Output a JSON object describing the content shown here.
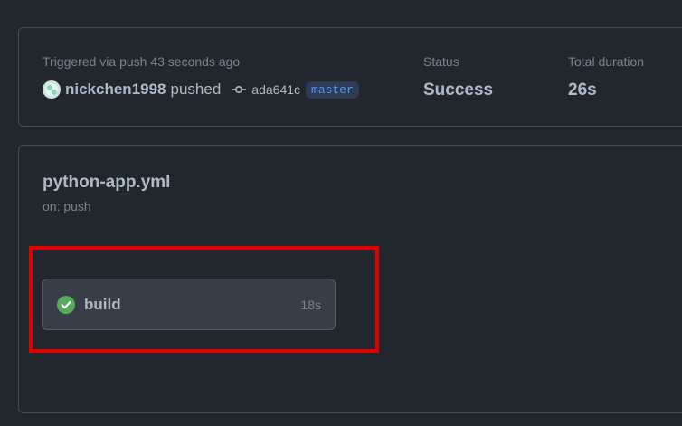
{
  "summary": {
    "trigger_text": "Triggered via push 43 seconds ago",
    "actor": "nickchen1998",
    "action": "pushed",
    "commit_sha": "ada641c",
    "branch": "master",
    "status_label": "Status",
    "status_value": "Success",
    "duration_label": "Total duration",
    "duration_value": "26s"
  },
  "workflow": {
    "file": "python-app.yml",
    "trigger": "on: push",
    "jobs": [
      {
        "name": "build",
        "duration": "18s",
        "status": "success",
        "status_icon": "check-circle-icon"
      }
    ]
  },
  "colors": {
    "background": "#22272e",
    "success": "#57ab5a",
    "branch_text": "#539bf5",
    "highlight": "#e00000"
  }
}
